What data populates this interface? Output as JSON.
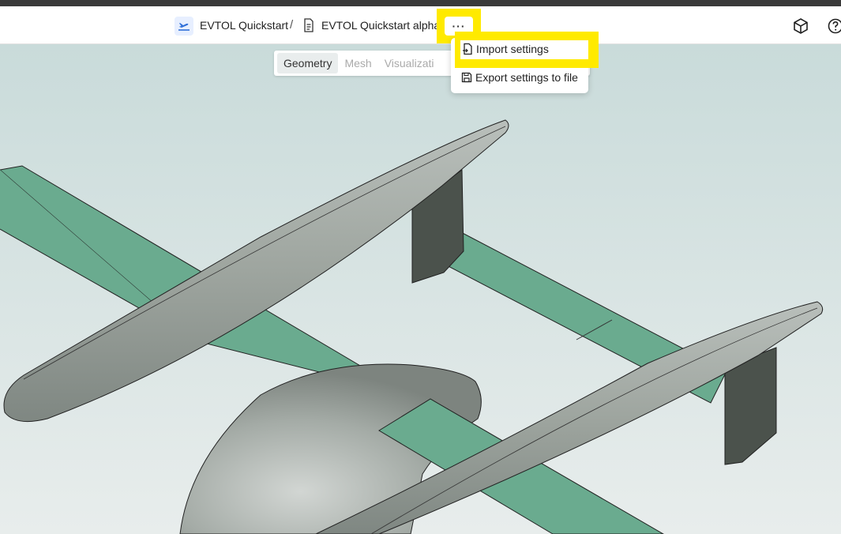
{
  "breadcrumb": {
    "project": "EVTOL Quickstart",
    "separator": "/",
    "document": "EVTOL Quickstart alpha"
  },
  "more_button": {
    "label": "···"
  },
  "tabs": [
    {
      "label": "Geometry",
      "active": true
    },
    {
      "label": "Mesh",
      "active": false
    },
    {
      "label": "Visualizati",
      "active": false
    }
  ],
  "menu": {
    "items": [
      {
        "label": "Import settings",
        "icon": "file-import-icon"
      },
      {
        "label": "Export settings to file",
        "icon": "save-icon"
      }
    ]
  },
  "header_icons": [
    "cube-icon",
    "help-icon"
  ],
  "colors": {
    "highlight": "#ffea00",
    "wing": "#6aab8f",
    "body": "#a4aba6",
    "fin": "#4b524c"
  }
}
